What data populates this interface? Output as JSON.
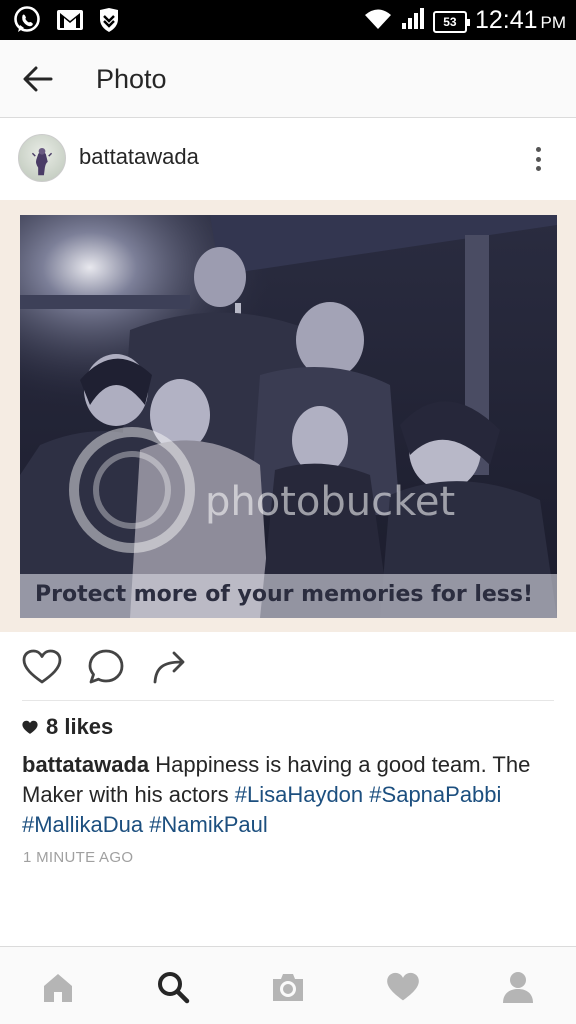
{
  "status_bar": {
    "battery": "53",
    "time": "12:41",
    "ampm": "PM",
    "icons": [
      "whatsapp-icon",
      "gmail-icon",
      "vpn-shield-icon",
      "wifi-icon",
      "signal-icon",
      "battery-icon"
    ]
  },
  "app_bar": {
    "title": "Photo"
  },
  "post": {
    "username": "battatawada",
    "photo": {
      "watermark": "photobucket",
      "promo": "Protect more of your memories for less!"
    },
    "likes": {
      "count": "8 likes"
    },
    "caption": {
      "username": "battatawada",
      "text": " Happiness is having a good team. The Maker with his actors ",
      "tags": [
        "#LisaHaydon",
        "#SapnaPabbi",
        "#MallikaDua",
        "#NamikPaul"
      ]
    },
    "timestamp": "1 MINUTE AGO"
  },
  "colors": {
    "hashtag": "#1c4f7f",
    "status_bar": "#000000",
    "app_bar": "#fafafa"
  },
  "bottom_nav": [
    "home-icon",
    "search-icon",
    "camera-icon",
    "activity-heart-icon",
    "profile-icon"
  ]
}
